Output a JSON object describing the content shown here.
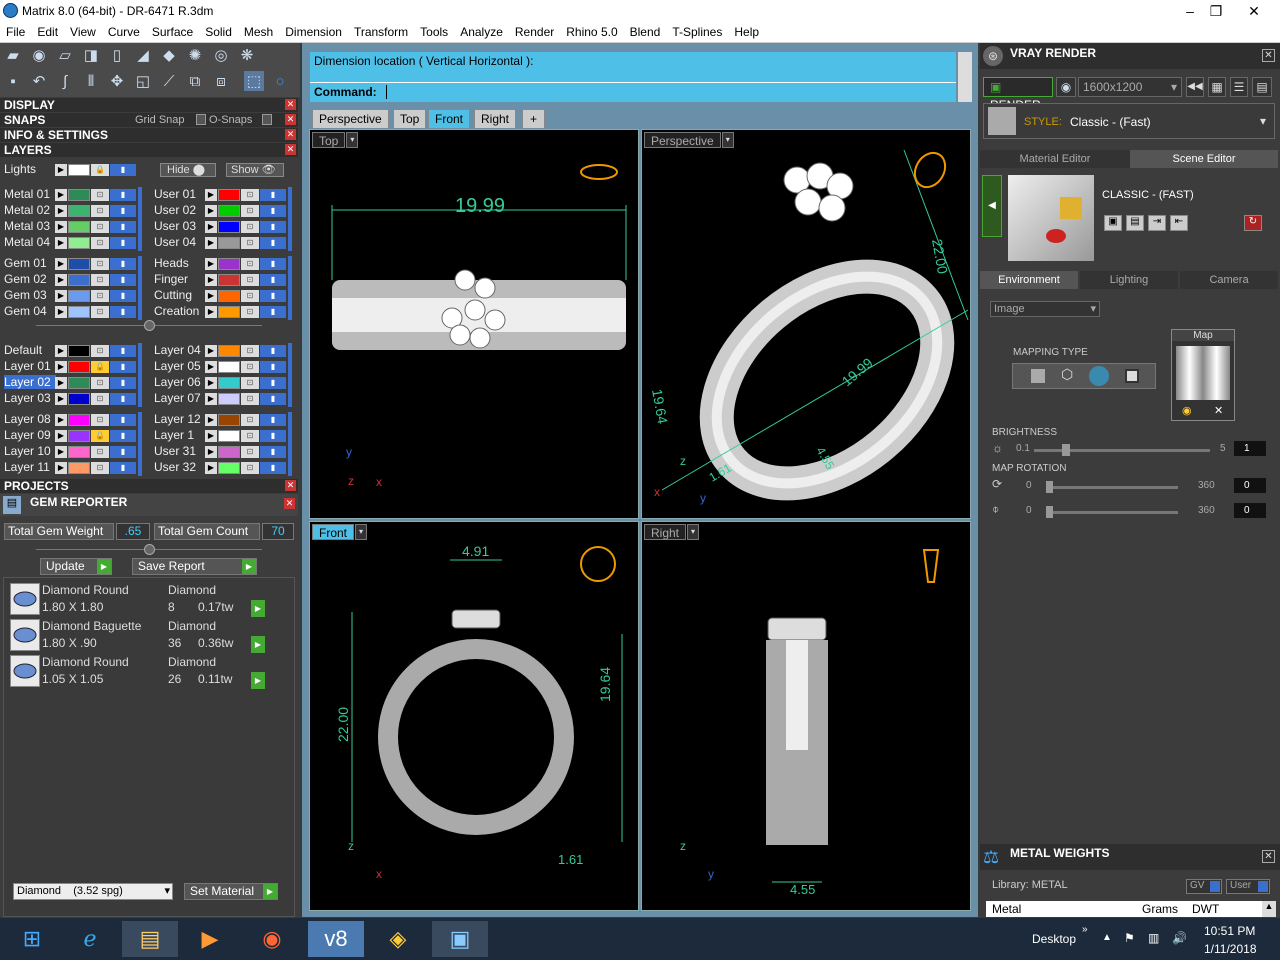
{
  "window": {
    "title": "Matrix 8.0 (64-bit) - DR-6471 R.3dm"
  },
  "menu": [
    "File",
    "Edit",
    "View",
    "Curve",
    "Surface",
    "Solid",
    "Mesh",
    "Dimension",
    "Transform",
    "Tools",
    "Analyze",
    "Render",
    "Rhino 5.0",
    "Blend",
    "T-Splines",
    "Help"
  ],
  "sections": {
    "display": "DISPLAY",
    "snaps": "SNAPS",
    "grid_snap": "Grid Snap",
    "o_snaps": "O-Snaps",
    "info": "INFO & SETTINGS",
    "layers": "LAYERS",
    "projects": "PROJECTS",
    "gem_reporter": "GEM REPORTER"
  },
  "layers_header": {
    "lights": "Lights",
    "hide": "Hide",
    "show": "Show"
  },
  "layers_left": [
    {
      "name": "Metal 01",
      "color": "#2e8b57"
    },
    {
      "name": "Metal 02",
      "color": "#3cb371"
    },
    {
      "name": "Metal 03",
      "color": "#66cc66"
    },
    {
      "name": "Metal 04",
      "color": "#90ee90"
    },
    {
      "name": "Gem 01",
      "color": "#1e4fa8"
    },
    {
      "name": "Gem 02",
      "color": "#3a6fd0"
    },
    {
      "name": "Gem 03",
      "color": "#6a9af0"
    },
    {
      "name": "Gem 04",
      "color": "#9ec4ff"
    },
    {
      "name": "Default",
      "color": "#000000"
    },
    {
      "name": "Layer 01",
      "color": "#ff0000"
    },
    {
      "name": "Layer 02",
      "color": "#2e8b57"
    },
    {
      "name": "Layer 03",
      "color": "#0000cc"
    },
    {
      "name": "Layer 08",
      "color": "#ff00ff"
    },
    {
      "name": "Layer 09",
      "color": "#9933ff"
    },
    {
      "name": "Layer 10",
      "color": "#ff66cc"
    },
    {
      "name": "Layer 11",
      "color": "#ff9966"
    }
  ],
  "layers_right": [
    {
      "name": "User 01",
      "color": "#ff0000"
    },
    {
      "name": "User 02",
      "color": "#00cc00"
    },
    {
      "name": "User 03",
      "color": "#0000ff"
    },
    {
      "name": "User 04",
      "color": "#999999"
    },
    {
      "name": "Heads",
      "color": "#9933cc"
    },
    {
      "name": "Finger",
      "color": "#cc3333"
    },
    {
      "name": "Cutting",
      "color": "#ff6600"
    },
    {
      "name": "Creation",
      "color": "#ff9900"
    },
    {
      "name": "Layer 04",
      "color": "#ff8800"
    },
    {
      "name": "Layer 05",
      "color": "#ffffff"
    },
    {
      "name": "Layer 06",
      "color": "#33cccc"
    },
    {
      "name": "Layer 07",
      "color": "#ccccff"
    },
    {
      "name": "Layer 12",
      "color": "#994400"
    },
    {
      "name": "Layer 1",
      "color": "#ffffff"
    },
    {
      "name": "User 31",
      "color": "#cc66cc"
    },
    {
      "name": "User 32",
      "color": "#66ff66"
    }
  ],
  "gem": {
    "total_weight_label": "Total Gem Weight",
    "total_weight": ".65",
    "total_count_label": "Total Gem Count",
    "total_count": "70",
    "update": "Update",
    "save_report": "Save Report",
    "rows": [
      {
        "name": "Diamond Round",
        "material": "Diamond",
        "size": "1.80 X 1.80",
        "count": "8",
        "weight": "0.17tw"
      },
      {
        "name": "Diamond Baguette",
        "material": "Diamond",
        "size": "1.80 X .90",
        "count": "36",
        "weight": "0.36tw"
      },
      {
        "name": "Diamond Round",
        "material": "Diamond",
        "size": "1.05 X 1.05",
        "count": "26",
        "weight": "0.11tw"
      }
    ],
    "material_select": "Diamond    (3.52 spg)",
    "set_material": "Set Material"
  },
  "command": {
    "prompt": "Dimension location ( Vertical  Horizontal ):",
    "label": "Command:"
  },
  "viewport_tabs": [
    "Perspective",
    "Top",
    "Front",
    "Right",
    "+"
  ],
  "viewports": {
    "top": {
      "label": "Top",
      "dim": "19.99"
    },
    "perspective": {
      "label": "Perspective",
      "dims": [
        "22.00",
        "19.64",
        "19.99",
        "1.61",
        "4.55"
      ]
    },
    "front": {
      "label": "Front",
      "dims": [
        "4.91",
        "22.00",
        "19.64",
        "1.61"
      ]
    },
    "right": {
      "label": "Right",
      "dim": "4.55"
    }
  },
  "vray": {
    "title": "VRAY RENDER",
    "render": "RENDER",
    "resolution": "1600x1200",
    "style_label": "STYLE:",
    "style": "Classic - (Fast)",
    "tabs": [
      "Material Editor",
      "Scene Editor"
    ],
    "preset": "CLASSIC - (FAST)",
    "env_tabs": [
      "Environment",
      "Lighting",
      "Camera"
    ],
    "env_type": "Image",
    "mapping_type": "MAPPING TYPE",
    "map": "Map",
    "brightness": "BRIGHTNESS",
    "b_min": "0.1",
    "b_max": "5",
    "b_val": "1",
    "map_rotation": "MAP ROTATION",
    "r1_min": "0",
    "r1_max": "360",
    "r1_val": "0",
    "r2_min": "0",
    "r2_max": "360",
    "r2_val": "0"
  },
  "metal": {
    "title": "METAL WEIGHTS",
    "library": "Library: METAL",
    "gv": "GV",
    "user": "User",
    "col1": "Metal",
    "col2": "Grams",
    "col3": "DWT"
  },
  "taskbar": {
    "desktop": "Desktop",
    "time": "10:51 PM",
    "date": "1/11/2018"
  }
}
